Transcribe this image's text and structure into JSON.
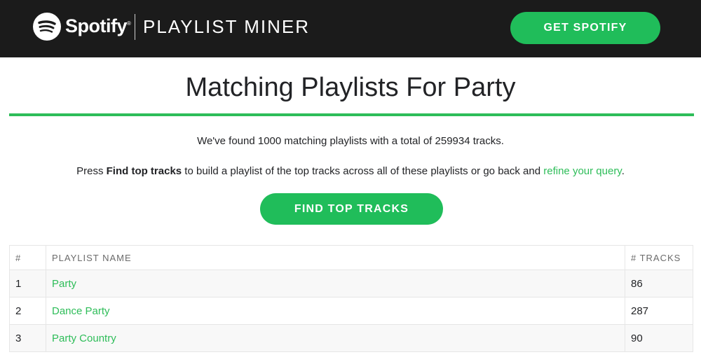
{
  "header": {
    "logo_text": "Spotify",
    "logo_icon": "spotify-logo-icon",
    "app_name": "PLAYLIST MINER",
    "get_button": "GET SPOTIFY"
  },
  "main": {
    "title": "Matching Playlists For Party",
    "found_prefix": "We've found ",
    "playlist_count": "1000",
    "found_middle": " matching playlists with a total of ",
    "track_total": "259934",
    "found_suffix": " tracks.",
    "instr_prefix": "Press ",
    "instr_bold": "Find top tracks",
    "instr_middle": " to build a playlist of the top tracks across all of these playlists or go back and ",
    "instr_link": "refine your query",
    "instr_suffix": ".",
    "find_button": "FIND TOP TRACKS"
  },
  "table": {
    "headers": [
      "#",
      "PLAYLIST NAME",
      "# TRACKS"
    ],
    "rows": [
      {
        "num": "1",
        "name": "Party",
        "tracks": "86"
      },
      {
        "num": "2",
        "name": "Dance Party",
        "tracks": "287"
      },
      {
        "num": "3",
        "name": "Party Country",
        "tracks": "90"
      }
    ]
  },
  "colors": {
    "accent": "#2ebd59",
    "header_bg": "#1b1b1b"
  }
}
